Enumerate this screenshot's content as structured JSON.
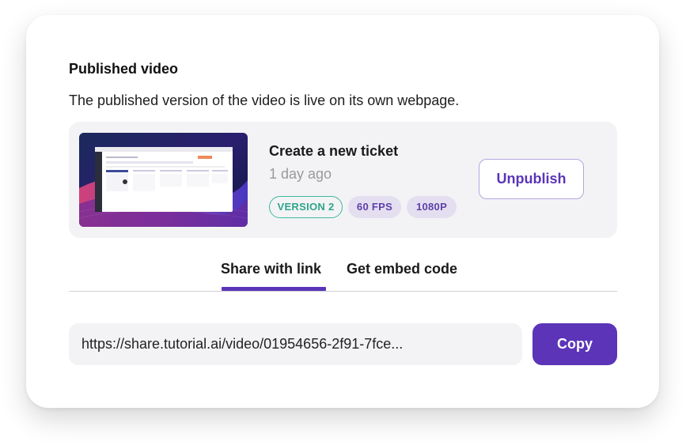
{
  "section": {
    "title": "Published video",
    "description": "The published version of the video is live on its own webpage."
  },
  "video": {
    "title": "Create a new ticket",
    "time": "1 day ago",
    "badges": {
      "version": "VERSION 2",
      "fps": "60 FPS",
      "resolution": "1080P"
    },
    "unpublish_label": "Unpublish"
  },
  "tabs": [
    {
      "label": "Share with link",
      "active": true
    },
    {
      "label": "Get embed code",
      "active": false
    }
  ],
  "share": {
    "url": "https://share.tutorial.ai/video/01954656-2f91-7fce...",
    "copy_label": "Copy"
  },
  "colors": {
    "accent": "#5b34b8",
    "version_badge": "#2fa58c",
    "badge_bg": "#e4dff0",
    "panel_bg": "#f3f3f5"
  }
}
